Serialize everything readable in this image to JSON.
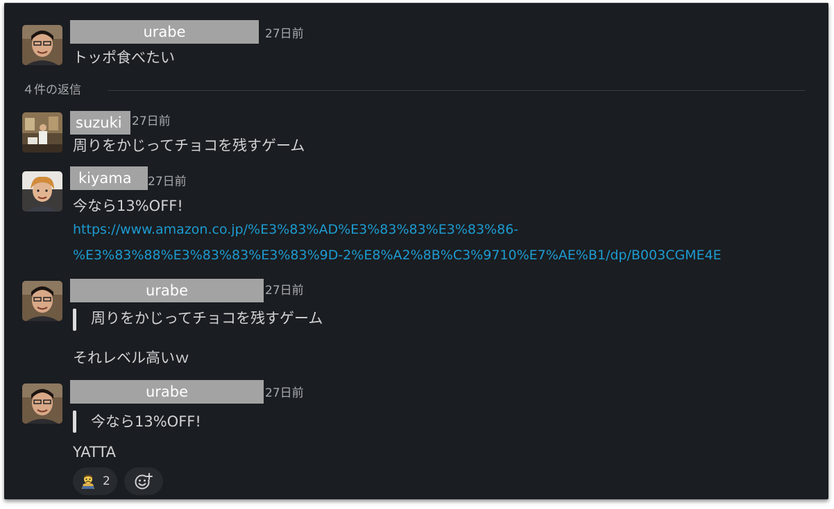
{
  "thread": {
    "parent": {
      "author": "urabe",
      "time": "27日前",
      "text": "トッポ食べたい"
    },
    "reply_count_label": "４件の返信",
    "replies": [
      {
        "author": "suzuki",
        "time": "27日前",
        "text": "周りをかじってチョコを残すゲーム"
      },
      {
        "author": "kiyama",
        "time": "27日前",
        "text": "今なら13%OFF!",
        "link_line1": "https://www.amazon.co.jp/%E3%83%AD%E3%83%83%E3%83%86-",
        "link_line2": "%E3%83%88%E3%83%83%E3%83%9D-2%E8%A2%8B%C3%9710%E7%AE%B1/dp/B003CGME4E"
      },
      {
        "author": "urabe",
        "time": "27日前",
        "quote": "周りをかじってチョコを残すゲーム",
        "text": "それレベル高いｗ"
      },
      {
        "author": "urabe",
        "time": "27日前",
        "quote": "今なら13%OFF!",
        "text": "YATTA",
        "reaction": {
          "emoji": "crying-person-emoji",
          "count": "2"
        },
        "add_reaction_icon": "add-emoji-icon"
      }
    ]
  },
  "colors": {
    "background": "#1a1d21",
    "text": "#d1d2d3",
    "muted": "#a8abae",
    "link": "#1d9bd1",
    "name_redaction": "#a3a3a3"
  }
}
